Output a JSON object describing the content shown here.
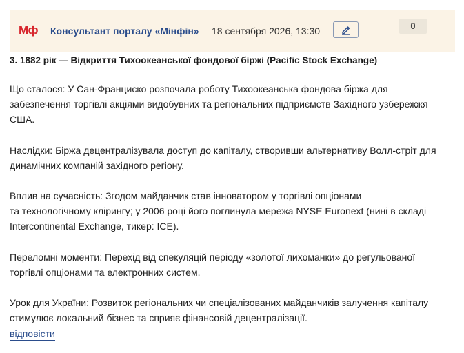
{
  "header": {
    "logo": "Мф",
    "author": "Консультант порталу «Мінфін»",
    "date": "18 сентября 2026, 13:30",
    "edit_icon": "pencil-icon",
    "counter": "0"
  },
  "post": {
    "title": "3. 1882 рік — Відкриття Тихоокеанської фондової біржі (Pacific Stock Exchange)",
    "paragraphs": [
      {
        "lines": [
          "Що сталося: У Сан-Франциско розпочала роботу Тихоокеанська фондова біржа для",
          "забезпечення торгівлі акціями видобувних та регіональних підприємств Західного узбережжя",
          "США."
        ]
      },
      {
        "lines": [
          "Наслідки: Біржа децентралізувала доступ до капіталу, створивши альтернативу Волл-стріт для",
          "динамічних компаній західного регіону."
        ]
      },
      {
        "lines": [
          "Вплив на сучасність: Згодом майданчик став інноватором у торгівлі опціонами",
          "та технологічному клірингу; у 2006 році його поглинула мережа NYSE Euronext (нині в складі",
          "Intercontinental Exchange, тикер: ICE)."
        ]
      },
      {
        "lines": [
          "Переломні моменти: Перехід від спекуляцій періоду «золотої лихоманки» до регульованої",
          "торгівлі опціонами та електронних систем."
        ]
      },
      {
        "lines": [
          "Урок для України: Розвиток регіональних чи спеціалізованих майданчиків залучення капіталу",
          "стимулює локальний бізнес та сприяє фінансовій децентралізації."
        ]
      }
    ],
    "reply_label": "відповісти"
  },
  "colors": {
    "header_bg": "#fbf3e6",
    "logo": "#d7262d",
    "link": "#2b4d8c"
  }
}
